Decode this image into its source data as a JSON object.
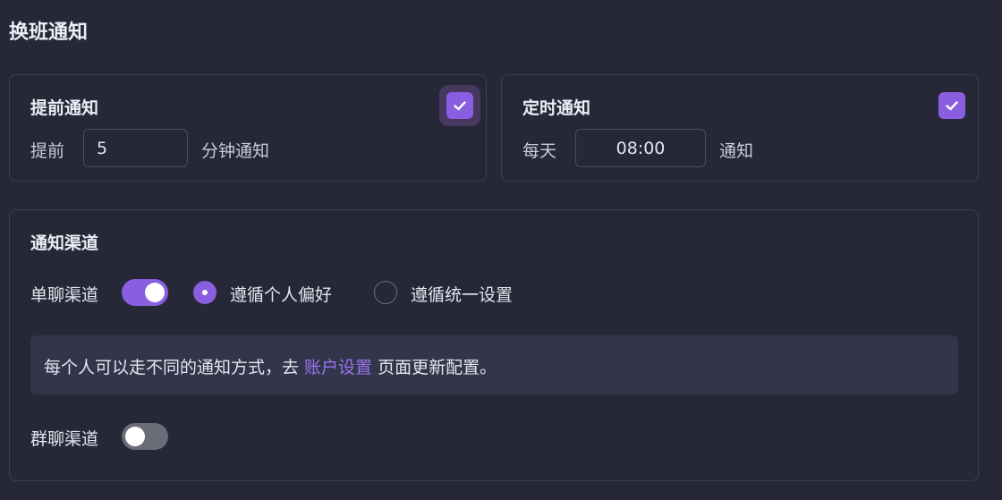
{
  "page_title": "换班通知",
  "advance": {
    "title": "提前通知",
    "prefix": "提前",
    "value": "5",
    "suffix": "分钟通知",
    "checked": true
  },
  "timed": {
    "title": "定时通知",
    "prefix": "每天",
    "value": "08:00",
    "suffix": "通知",
    "checked": true
  },
  "channel": {
    "title": "通知渠道",
    "single_chat_label": "单聊渠道",
    "single_chat_enabled": true,
    "options": [
      {
        "label": "遵循个人偏好",
        "selected": true
      },
      {
        "label": "遵循统一设置",
        "selected": false
      }
    ],
    "notice": {
      "before": "每个人可以走不同的通知方式，去 ",
      "link": "账户设置",
      "after": " 页面更新配置。"
    },
    "group_chat_label": "群聊渠道",
    "group_chat_enabled": false
  },
  "colors": {
    "accent": "#8a5ee0",
    "link": "#9b72ef",
    "background": "#262837"
  },
  "icons": {
    "checkbox": "checkmark-icon"
  }
}
